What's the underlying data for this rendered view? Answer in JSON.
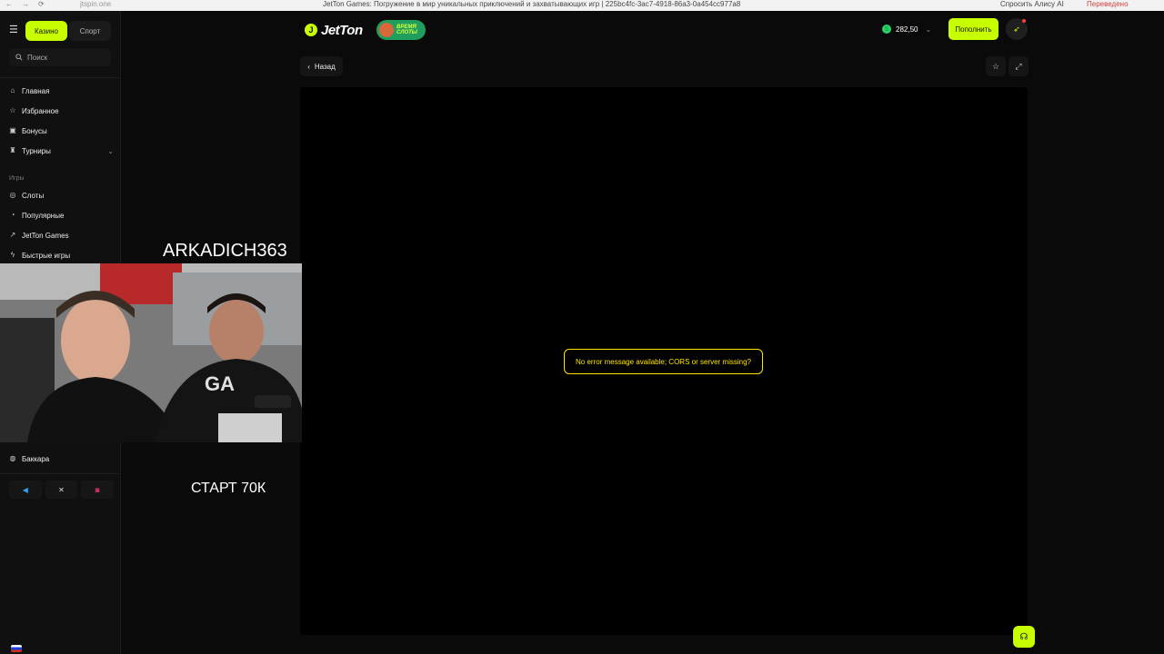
{
  "browser": {
    "url": "jtspin.one",
    "tab_title": "JetTon Games: Погружение в мир уникальных приключений и захватывающих игр | 225bc4fc-3ac7-4918-86a3-0a454cc977a8",
    "alice": "Спросить Алису AI",
    "translated": "Переведено"
  },
  "sidebar": {
    "tab_casino": "Казино",
    "tab_sport": "Спорт",
    "search_placeholder": "Поиск",
    "main_items": [
      {
        "label": "Главная",
        "icon": "home-icon"
      },
      {
        "label": "Избранное",
        "icon": "star-icon"
      },
      {
        "label": "Бонусы",
        "icon": "gift-icon"
      },
      {
        "label": "Турниры",
        "icon": "trophy-icon"
      }
    ],
    "games_section": "Игры",
    "game_items": [
      {
        "label": "Слоты",
        "icon": "slot-icon"
      },
      {
        "label": "Популярные",
        "icon": "fire-icon"
      },
      {
        "label": "JetTon Games",
        "icon": "rocket-icon"
      },
      {
        "label": "Быстрые игры",
        "icon": "bolt-icon"
      },
      {
        "label": "Баккара",
        "icon": "cards-icon"
      }
    ],
    "socials": [
      "telegram-icon",
      "x-icon",
      "instagram-icon"
    ]
  },
  "header": {
    "logo": "JetTon",
    "promo_line1": "ВРЕМЯ",
    "promo_line2": "СЛОТЫ",
    "balance": "282,50",
    "deposit_label": "Пополнить"
  },
  "game": {
    "back_label": "Назад",
    "error_message": "No error message available; CORS or server missing?"
  },
  "stream_overlay": {
    "streamer_name": "ARKADICH363",
    "start_text": "СТАРТ 70К"
  },
  "colors": {
    "accent": "#c8ff00",
    "background": "#0a0a0a",
    "sidebar": "#101010",
    "error": "#ffe500"
  }
}
